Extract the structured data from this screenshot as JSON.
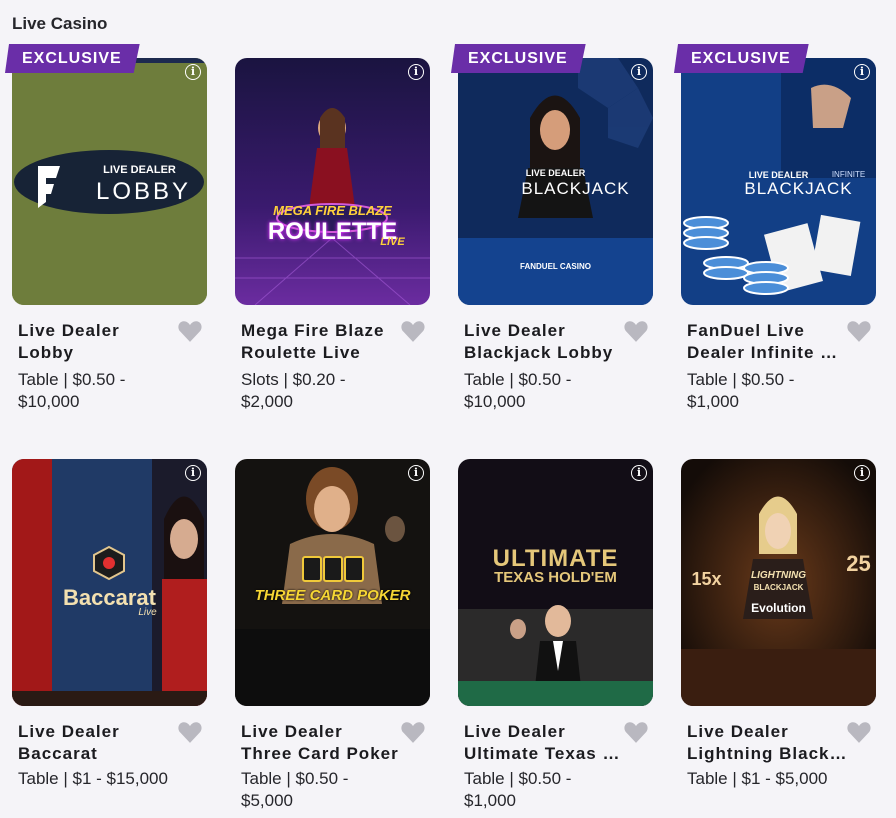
{
  "section": {
    "title": "Live Casino"
  },
  "games": [
    {
      "badge": "EXCLUSIVE",
      "name_lines": [
        "Live Dealer",
        "Lobby"
      ],
      "meta_lines": [
        "Table | $0.50 -",
        "$10,000"
      ],
      "art_top": "LIVE DEALER",
      "art_main": "LOBBY"
    },
    {
      "badge": "",
      "name_lines": [
        "Mega Fire Blaze",
        "Roulette Live"
      ],
      "meta_lines": [
        "Slots | $0.20 -",
        "$2,000"
      ],
      "art_top": "MEGA FIRE BLAZE",
      "art_main": "ROULETTE",
      "art_sub": "LIVE"
    },
    {
      "badge": "EXCLUSIVE",
      "name_lines": [
        "Live Dealer",
        "Blackjack Lobby"
      ],
      "meta_lines": [
        "Table | $0.50 -",
        "$10,000"
      ],
      "art_top": "LIVE DEALER",
      "art_main": "BLACKJACK",
      "art_sub": "FANDUEL CASINO"
    },
    {
      "badge": "EXCLUSIVE",
      "name_lines": [
        "FanDuel Live",
        "Dealer Infinite Blackjack"
      ],
      "meta_lines": [
        "Table | $0.50 -",
        "$1,000"
      ],
      "art_top": "LIVE DEALER",
      "art_main": "BLACKJACK",
      "art_sub": "INFINITE"
    },
    {
      "badge": "",
      "name_lines": [
        "Live Dealer",
        "Baccarat"
      ],
      "meta_lines": [
        "Table | $1 - $15,000"
      ],
      "art_main": "Baccarat",
      "art_sub": "Live"
    },
    {
      "badge": "",
      "name_lines": [
        "Live Dealer",
        "Three Card Poker"
      ],
      "meta_lines": [
        "Table | $0.50 -",
        "$5,000"
      ],
      "art_main": "THREE CARD POKER"
    },
    {
      "badge": "",
      "name_lines": [
        "Live Dealer",
        "Ultimate Texas Hold'em"
      ],
      "meta_lines": [
        "Table | $0.50 -",
        "$1,000"
      ],
      "art_main": "ULTIMATE",
      "art_sub": "TEXAS HOLD'EM"
    },
    {
      "badge": "",
      "name_lines": [
        "Live Dealer",
        "Lightning Blackjack"
      ],
      "meta_lines": [
        "Table | $1 - $5,000"
      ],
      "art_top": "LIGHTNING",
      "art_main": "BLACKJACK",
      "art_sub": "Evolution",
      "art_mult_left": "15x",
      "art_mult_right": "25"
    }
  ],
  "icons": {
    "info": "info-icon",
    "favorite": "heart-icon"
  },
  "colors": {
    "badge": "#6a2ea8",
    "favorite": "#b9b8c0"
  }
}
